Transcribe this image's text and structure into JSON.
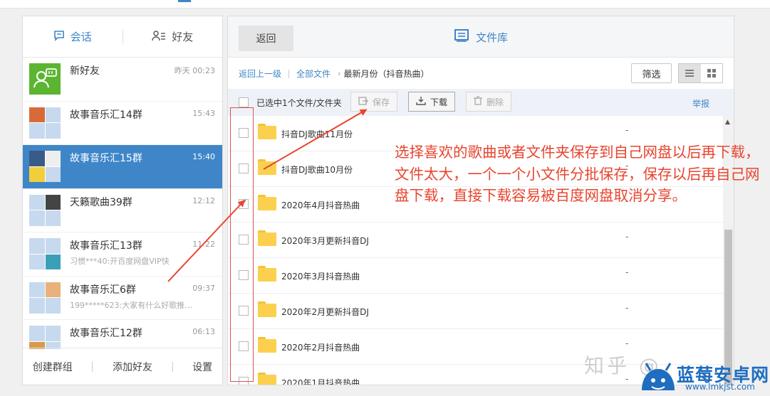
{
  "left_tabs": [
    {
      "label": "会话",
      "icon": "chat-icon",
      "active": true
    },
    {
      "label": "好友",
      "icon": "contacts-icon",
      "active": false
    }
  ],
  "conversations": [
    {
      "name": "新好友",
      "time": "昨天 00:23",
      "subtitle": "",
      "avatar": "new-friend-avatar",
      "selected": false
    },
    {
      "name": "故事音乐汇14群",
      "time": "15:43",
      "subtitle": "",
      "avatar": "group-avatar",
      "selected": false
    },
    {
      "name": "故事音乐汇15群",
      "time": "15:40",
      "subtitle": "",
      "avatar": "group-avatar",
      "selected": true
    },
    {
      "name": "天籁歌曲39群",
      "time": "12:12",
      "subtitle": "",
      "avatar": "group-avatar",
      "selected": false
    },
    {
      "name": "故事音乐汇13群",
      "time": "11:22",
      "subtitle": "习惯***40:开百度网盘VIP快",
      "avatar": "group-avatar",
      "selected": false
    },
    {
      "name": "故事音乐汇6群",
      "time": "09:37",
      "subtitle": "199*****623:大家有什么好歌推…",
      "avatar": "group-avatar",
      "selected": false
    },
    {
      "name": "故事音乐汇12群",
      "time": "06:13",
      "subtitle": "",
      "avatar": "group-avatar",
      "selected": false
    }
  ],
  "left_bottom": {
    "create_group": "创建群组",
    "add_friend": "添加好友",
    "settings": "设置"
  },
  "right_header": {
    "back_label": "返回",
    "title": "文件库"
  },
  "breadcrumb": {
    "back_up": "返回上一级",
    "all_files": "全部文件",
    "current": "最新月份（抖音热曲）"
  },
  "filter_label": "筛选",
  "toolbar": {
    "selection_text": "已选中1个文件/文件夹",
    "save_label": "保存",
    "download_label": "下载",
    "delete_label": "删除",
    "report_label": "举报"
  },
  "files": [
    {
      "name": "抖音DJ歌曲11月份",
      "size": "-",
      "checked": false
    },
    {
      "name": "抖音DJ歌曲10月份",
      "size": "-",
      "checked": false
    },
    {
      "name": "2020年4月抖音热曲",
      "size": "-",
      "checked": true
    },
    {
      "name": "2020年3月更新抖音DJ",
      "size": "-",
      "checked": false
    },
    {
      "name": "2020年3月抖音热曲",
      "size": "-",
      "checked": false
    },
    {
      "name": "2020年2月更新抖音DJ",
      "size": "-",
      "checked": false
    },
    {
      "name": "2020年2月抖音热曲",
      "size": "-",
      "checked": false
    },
    {
      "name": "2020年1月抖音热曲",
      "size": "-",
      "checked": false
    }
  ],
  "annotation": "选择喜欢的歌曲或者文件夹保存到自己网盘以后再下载，文件太大，一个一个小文件分批保存，保存以后再自己网盘下载，直接下载容易被百度网盘取消分享。",
  "watermark": {
    "zhihu": "知乎 @",
    "site_title": "蓝莓安卓网",
    "site_url": "www.lmkjst.com"
  },
  "colors": {
    "accent": "#3f86c9",
    "annotation": "#e8452f",
    "folder": "#fcd04f",
    "selected_row": "#3f86c9"
  }
}
